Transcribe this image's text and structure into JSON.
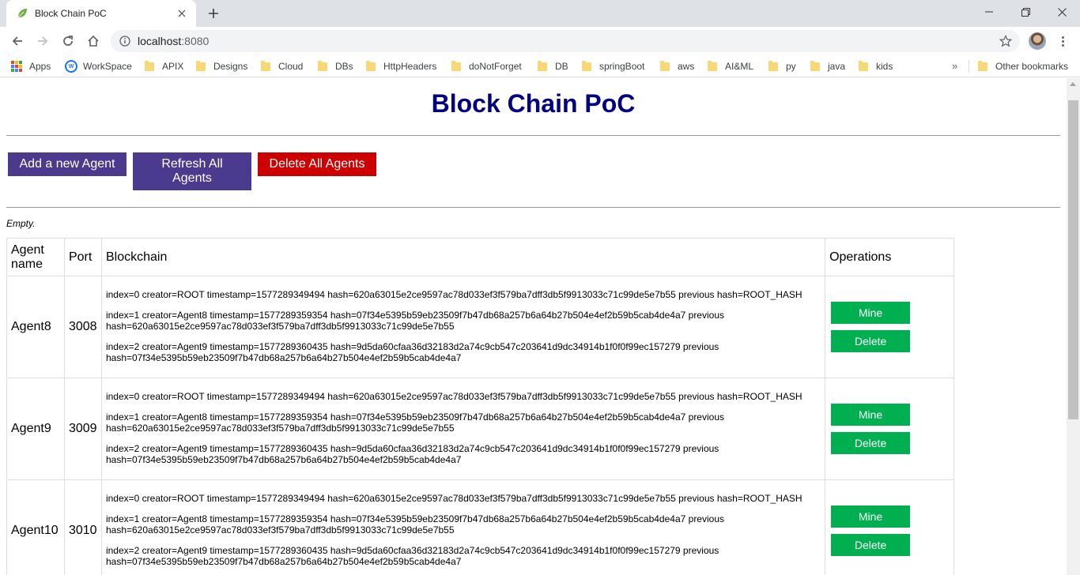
{
  "browser": {
    "tab_title": "Block Chain PoC",
    "url_host": "localhost",
    "url_port": ":8080",
    "bookmarks": [
      "Apps",
      "WorkSpace",
      "APIX",
      "Designs",
      "Cloud",
      "DBs",
      "HttpHeaders",
      "doNotForget",
      "DB",
      "springBoot",
      "aws",
      "AI&ML",
      "py",
      "java",
      "kids"
    ],
    "other_bookmarks": "Other bookmarks",
    "more_chevron": "»"
  },
  "page": {
    "title": "Block Chain PoC",
    "buttons": {
      "add": "Add a new Agent",
      "refresh": "Refresh All Agents",
      "delete_all": "Delete All Agents"
    },
    "status": "Empty.",
    "table": {
      "headers": [
        "Agent name",
        "Port",
        "Blockchain",
        "Operations"
      ],
      "op_labels": {
        "mine": "Mine",
        "delete": "Delete"
      },
      "rows": [
        {
          "name": "Agent8",
          "port": "3008",
          "blocks": [
            "index=0 creator=ROOT timestamp=1577289349494 hash=620a63015e2ce9597ac78d033ef3f579ba7dff3db5f9913033c71c99de5e7b55 previous hash=ROOT_HASH",
            "index=1 creator=Agent8 timestamp=1577289359354 hash=07f34e5395b59eb23509f7b47db68a257b6a64b27b504e4ef2b59b5cab4de4a7 previous hash=620a63015e2ce9597ac78d033ef3f579ba7dff3db5f9913033c71c99de5e7b55",
            "index=2 creator=Agent9 timestamp=1577289360435 hash=9d5da60cfaa36d32183d2a74c9cb547c203641d9dc34914b1f0f0f99ec157279 previous hash=07f34e5395b59eb23509f7b47db68a257b6a64b27b504e4ef2b59b5cab4de4a7"
          ]
        },
        {
          "name": "Agent9",
          "port": "3009",
          "blocks": [
            "index=0 creator=ROOT timestamp=1577289349494 hash=620a63015e2ce9597ac78d033ef3f579ba7dff3db5f9913033c71c99de5e7b55 previous hash=ROOT_HASH",
            "index=1 creator=Agent8 timestamp=1577289359354 hash=07f34e5395b59eb23509f7b47db68a257b6a64b27b504e4ef2b59b5cab4de4a7 previous hash=620a63015e2ce9597ac78d033ef3f579ba7dff3db5f9913033c71c99de5e7b55",
            "index=2 creator=Agent9 timestamp=1577289360435 hash=9d5da60cfaa36d32183d2a74c9cb547c203641d9dc34914b1f0f0f99ec157279 previous hash=07f34e5395b59eb23509f7b47db68a257b6a64b27b504e4ef2b59b5cab4de4a7"
          ]
        },
        {
          "name": "Agent10",
          "port": "3010",
          "blocks": [
            "index=0 creator=ROOT timestamp=1577289349494 hash=620a63015e2ce9597ac78d033ef3f579ba7dff3db5f9913033c71c99de5e7b55 previous hash=ROOT_HASH",
            "index=1 creator=Agent8 timestamp=1577289359354 hash=07f34e5395b59eb23509f7b47db68a257b6a64b27b504e4ef2b59b5cab4de4a7 previous hash=620a63015e2ce9597ac78d033ef3f579ba7dff3db5f9913033c71c99de5e7b55",
            "index=2 creator=Agent9 timestamp=1577289360435 hash=9d5da60cfaa36d32183d2a74c9cb547c203641d9dc34914b1f0f0f99ec157279 previous hash=07f34e5395b59eb23509f7b47db68a257b6a64b27b504e4ef2b59b5cab4de4a7"
          ]
        }
      ]
    }
  },
  "colors": {
    "title": "#000080",
    "purple_button": "#4b3b8f",
    "red_button": "#cc0000",
    "green_button": "#00b050"
  }
}
